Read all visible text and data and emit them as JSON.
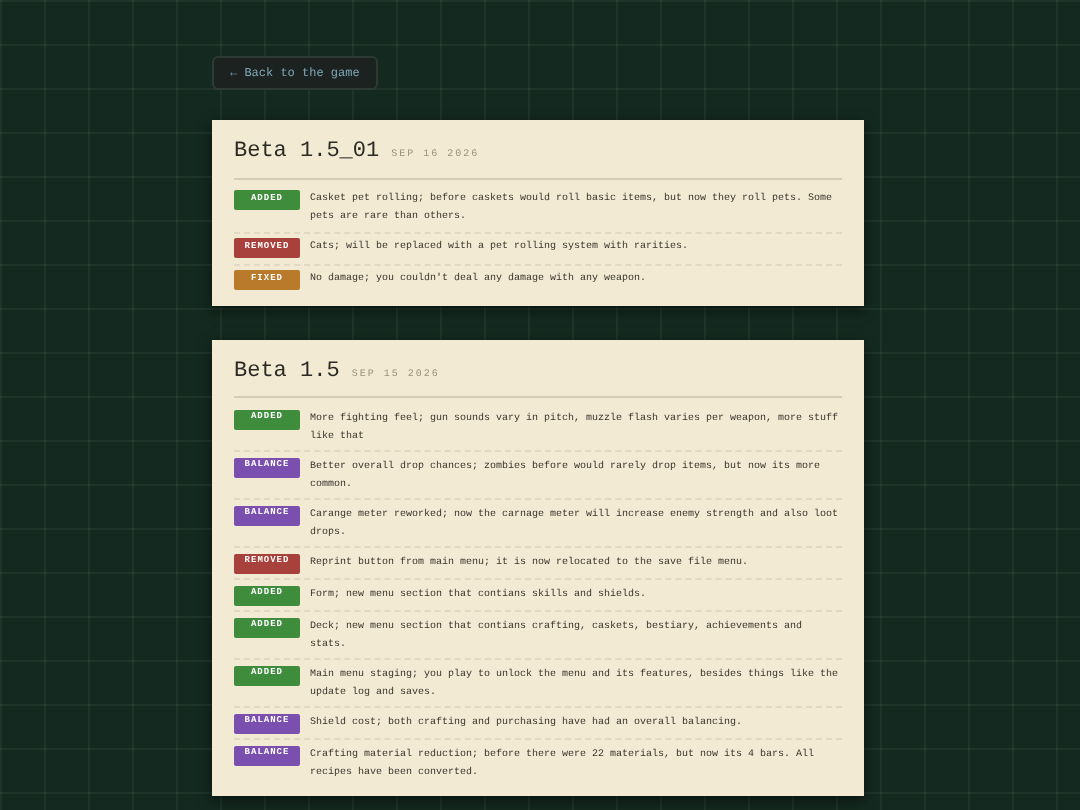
{
  "back_link": "← Back to the game",
  "releases": [
    {
      "title": "Beta 1.5_01",
      "date": "SEP 16 2026",
      "entries": [
        {
          "kind": "added",
          "tag": "ADDED",
          "text": "Casket pet rolling; before caskets would roll basic items, but now they roll pets. Some pets are rare than others."
        },
        {
          "kind": "removed",
          "tag": "REMOVED",
          "text": "Cats; will be replaced with a pet rolling system with rarities."
        },
        {
          "kind": "fixed",
          "tag": "FIXED",
          "text": "No damage; you couldn't deal any damage with any weapon."
        }
      ]
    },
    {
      "title": "Beta 1.5",
      "date": "SEP 15 2026",
      "entries": [
        {
          "kind": "added",
          "tag": "ADDED",
          "text": "More fighting feel; gun sounds vary in pitch, muzzle flash varies per weapon, more stuff like that"
        },
        {
          "kind": "balance",
          "tag": "BALANCE",
          "text": "Better overall drop chances; zombies before would rarely drop items, but now its more common."
        },
        {
          "kind": "balance",
          "tag": "BALANCE",
          "text": "Carange meter reworked; now the carnage meter will increase enemy strength and also loot drops."
        },
        {
          "kind": "removed",
          "tag": "REMOVED",
          "text": "Reprint button from main menu; it is now relocated to the save file menu."
        },
        {
          "kind": "added",
          "tag": "ADDED",
          "text": "Form; new menu section that contians skills and shields."
        },
        {
          "kind": "added",
          "tag": "ADDED",
          "text": "Deck; new menu section that contians crafting, caskets, bestiary, achievements and stats."
        },
        {
          "kind": "added",
          "tag": "ADDED",
          "text": "Main menu staging; you play to unlock the menu and its features, besides things like the update log and saves."
        },
        {
          "kind": "balance",
          "tag": "BALANCE",
          "text": "Shield cost; both crafting and purchasing have had an overall balancing."
        },
        {
          "kind": "balance",
          "tag": "BALANCE",
          "text": "Crafting material reduction; before there were 22 materials, but now its 4 bars. All recipes have been converted."
        }
      ]
    }
  ]
}
